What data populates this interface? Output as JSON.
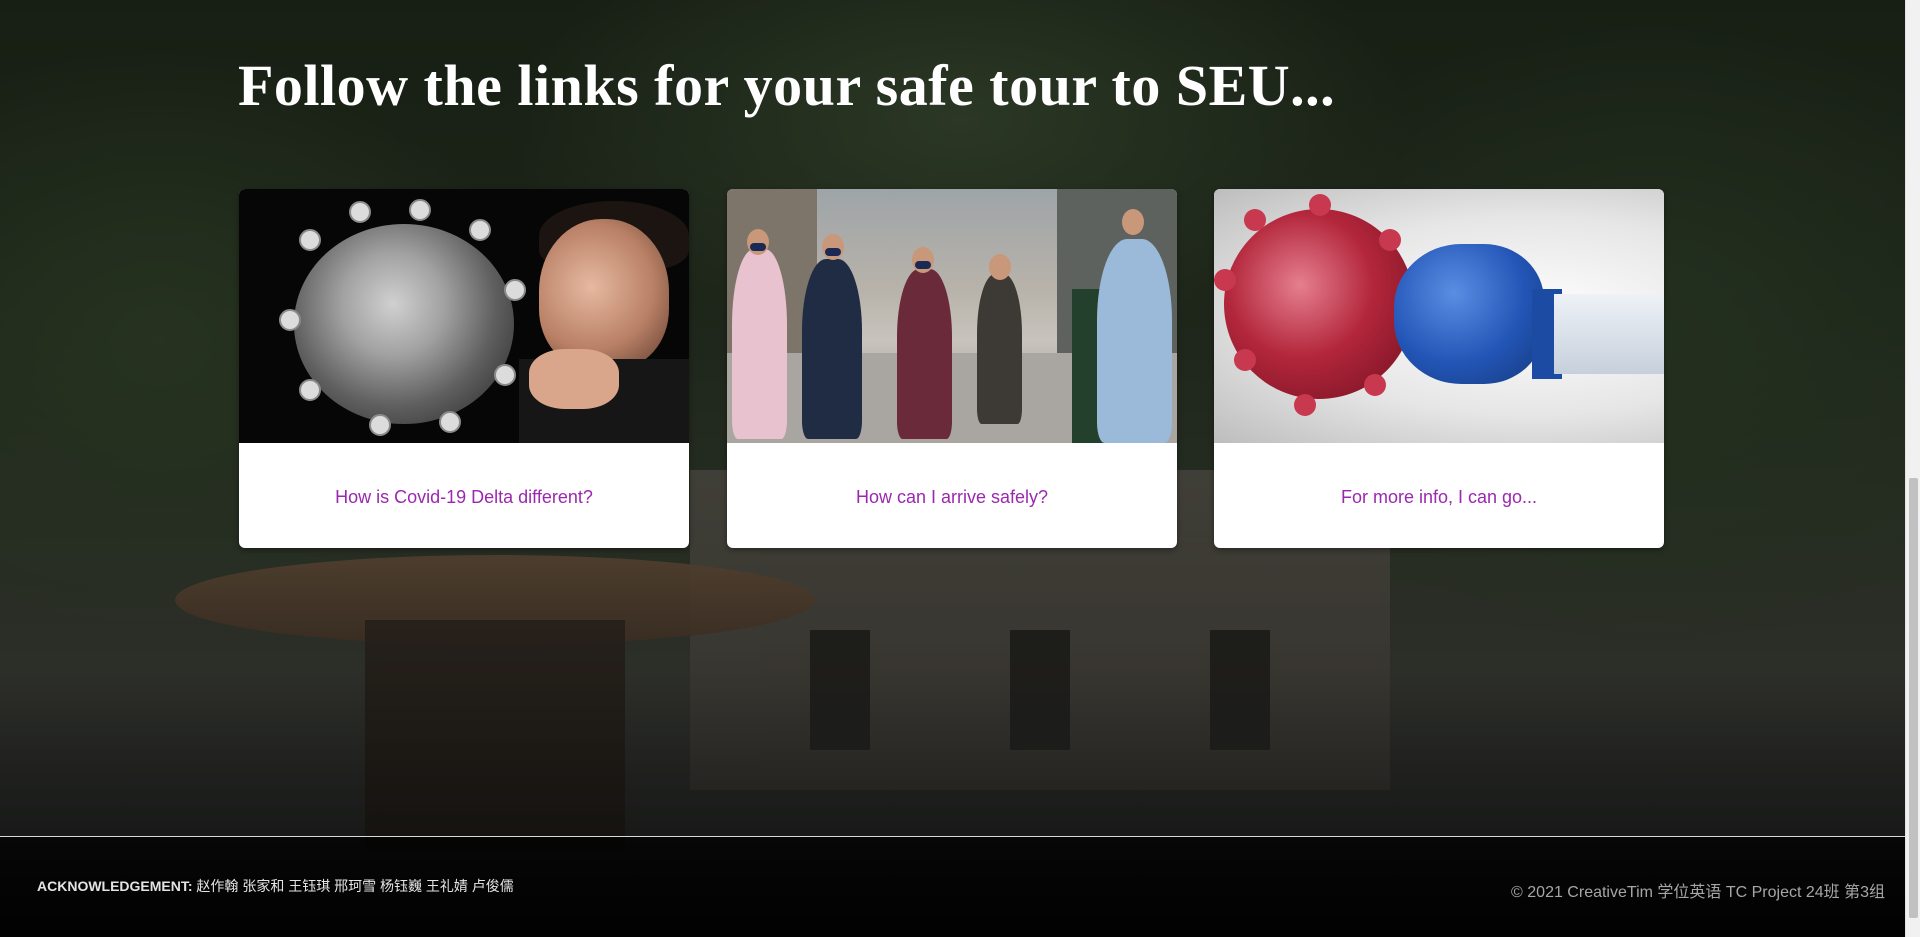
{
  "heading": "Follow the links for your safe tour to SEU...",
  "cards": [
    {
      "link_text": "How is Covid-19 Delta different?",
      "image_icon": "glass-virus-sculpture-photo"
    },
    {
      "link_text": "How can I arrive safely?",
      "image_icon": "masked-pedestrians-street-photo"
    },
    {
      "link_text": "For more info, I can go...",
      "image_icon": "virus-boxing-glove-photo"
    }
  ],
  "footer": {
    "ack_label": "ACKNOWLEDGEMENT:",
    "ack_names": " 赵作翰 张家和 王钰琪 邢珂雪 杨钰巍 王礼婧 卢俊儒",
    "copyright": "© 2021 CreativeTim 学位英语 TC Project 24班 第3组"
  },
  "colors": {
    "link": "#9c27b0",
    "heading": "#ffffff",
    "card_bg": "#ffffff"
  }
}
